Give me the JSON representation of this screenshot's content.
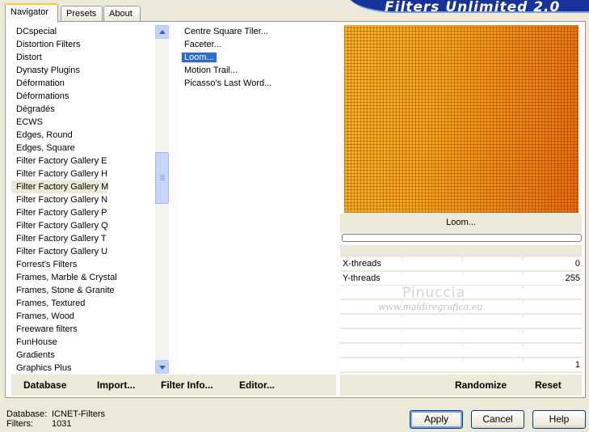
{
  "app": {
    "logo_text": "Filters Unlimited 2.0"
  },
  "tabs": [
    {
      "label": "Navigator",
      "active": true
    },
    {
      "label": "Presets",
      "active": false
    },
    {
      "label": "About",
      "active": false
    }
  ],
  "categories": {
    "items": [
      "DCspecial",
      "Distortion Filters",
      "Distort",
      "Dynasty Plugins",
      "Déformation",
      "Déformations",
      "Dégradés",
      "ECWS",
      "Edges, Round",
      "Edges, Square",
      "Filter Factory Gallery E",
      "Filter Factory Gallery H",
      "Filter Factory Gallery M",
      "Filter Factory Gallery N",
      "Filter Factory Gallery P",
      "Filter Factory Gallery Q",
      "Filter Factory Gallery T",
      "Filter Factory Gallery U",
      "Forrest's Filters",
      "Frames, Marble & Crystal",
      "Frames, Stone & Granite",
      "Frames, Textured",
      "Frames, Wood",
      "Freeware filters",
      "FunHouse",
      "Gradients",
      "Graphics Plus"
    ],
    "selected_index": 12
  },
  "filters": {
    "items": [
      "Centre Square Tiler...",
      "Faceter...",
      "Loom...",
      "Motion Trail...",
      "Picasso's Last Word..."
    ],
    "selected_index": 2
  },
  "toolbar": {
    "database_label": "Database",
    "import_label": "Import...",
    "filter_info_label": "Filter Info...",
    "editor_label": "Editor..."
  },
  "preview": {
    "filter_name": "Loom..."
  },
  "params": [
    {
      "label": "X-threads",
      "value": "0"
    },
    {
      "label": "Y-threads",
      "value": "255"
    },
    {
      "label": "",
      "value": ""
    },
    {
      "label": "",
      "value": ""
    },
    {
      "label": "",
      "value": ""
    },
    {
      "label": "",
      "value": ""
    },
    {
      "label": "",
      "value": ""
    },
    {
      "label": "",
      "value": "1"
    }
  ],
  "param_toolbar": {
    "randomize_label": "Randomize",
    "reset_label": "Reset"
  },
  "watermark": {
    "name": "Pinuccia",
    "url": "www.maidiregrafica.eu"
  },
  "status": {
    "database_key": "Database:",
    "database_value": "ICNET-Filters",
    "filters_key": "Filters:",
    "filters_value": "1031"
  },
  "buttons": {
    "apply": "Apply",
    "cancel": "Cancel",
    "help": "Help"
  }
}
